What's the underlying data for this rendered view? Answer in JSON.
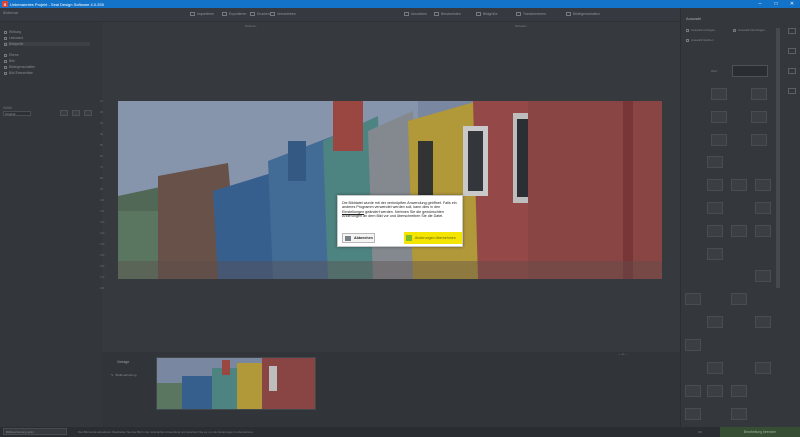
{
  "window": {
    "title": "Unbenanntes Projekt - Seal Design Software 4.0.255",
    "controls": [
      "minimize",
      "maximize",
      "close"
    ]
  },
  "toolbar": {
    "left_label": "Bildformat",
    "items": [
      "Importieren",
      "Exportieren",
      "Drucken",
      "Verschieben",
      "Ausrichten",
      "Beschneiden",
      "Bildgröße",
      "Transformieren",
      "Bildeigenschaften"
    ]
  },
  "tree": {
    "items": [
      "Wirkung",
      "Leinwand",
      "Bildquelle",
      "Ebene",
      "Bild",
      "Bildeigenschaften",
      "Bild-Ebenenliste"
    ]
  },
  "left": {
    "size_label": "Größe",
    "size_value": "Original"
  },
  "ruler": {
    "top_a": "Rahmen",
    "top_b": "Schatten",
    "left_ticks": [
      "10",
      "20",
      "30",
      "40",
      "50",
      "60",
      "70",
      "80",
      "90",
      "100",
      "110",
      "120",
      "130",
      "140",
      "150",
      "160",
      "170",
      "180"
    ]
  },
  "filmstrip": {
    "title": "Vorlage",
    "subtitle": "Bildbearbeitung"
  },
  "status": {
    "left": "Bildbearbeitung aktiv",
    "text": "Das Bild wurde aktualisiert. Bearbeiten Sie das Bild in der verknüpften Anwendung und speichern Sie es, um die Änderungen zu übernehmen.",
    "coords": "0/0",
    "green": "Bearbeitung beenden"
  },
  "right": {
    "title": "Auswahl",
    "opt1": "Auswahl anzeigen",
    "opt2": "Auswahl hinzufügen",
    "opt3": "Auswahl löschen",
    "field_label": "Wert"
  },
  "dialog": {
    "message_before": "Die Bilddatei wurde mit der verknüpften Anwendung geöffnet. Falls ein anderes Programm verwendet werden soll, kann dies in den ",
    "link": "Einstellungen",
    "message_after": " geändert werden. Nehmen Sie die gewünschten Änderungen an dem Bild vor und überschreiben Sie die Datei.",
    "cancel": "Abbrechen",
    "ok": "Änderungen übernehmen"
  },
  "colors": {
    "titlebar": "#1273c9",
    "accent_yellow": "#f4e500",
    "ok_icon_green": "#7dba2e"
  }
}
